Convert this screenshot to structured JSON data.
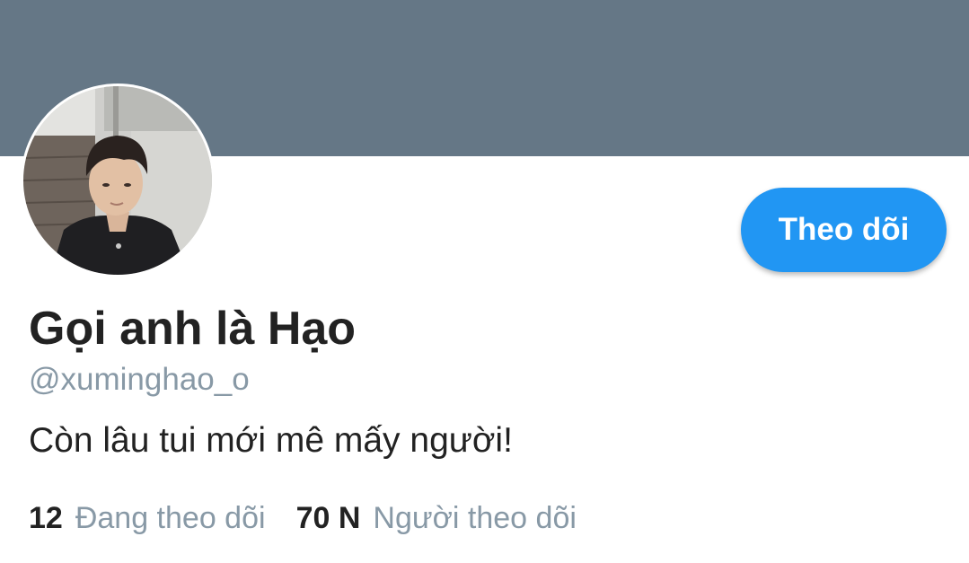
{
  "profile": {
    "display_name": "Gọi anh là Hạo",
    "handle": "@xuminghao_o",
    "bio": "Còn lâu tui mới mê mấy người!",
    "follow_label": "Theo dõi",
    "avatar_icon": "profile-photo",
    "stats": {
      "following_count": "12",
      "following_label": "Đang theo dõi",
      "followers_count": "70 N",
      "followers_label": "Người theo dõi"
    }
  },
  "colors": {
    "banner": "#657786",
    "accent": "#2196f3",
    "text_primary": "#222222",
    "text_secondary": "#8899a6"
  }
}
